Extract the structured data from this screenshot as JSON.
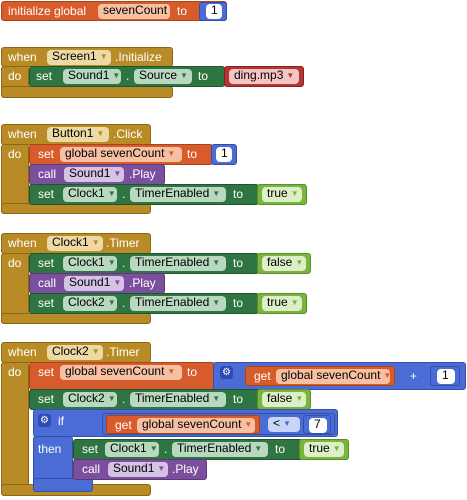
{
  "blocks": {
    "init_global": {
      "kw_initialize": "initialize global",
      "var_name": "sevenCount",
      "kw_to": "to",
      "value": "1"
    },
    "screen_init": {
      "kw_when": "when",
      "component": "Screen1",
      "event": ".Initialize",
      "kw_do": "do",
      "set_sound": {
        "kw_set": "set",
        "component": "Sound1",
        "dot": ".",
        "property": "Source",
        "kw_to": "to",
        "value": "ding.mp3"
      }
    },
    "button_click": {
      "kw_when": "when",
      "component": "Button1",
      "event": ".Click",
      "kw_do": "do",
      "set_global": {
        "kw_set": "set",
        "var": "global sevenCount",
        "kw_to": "to",
        "value": "1"
      },
      "call_play": {
        "kw_call": "call",
        "component": "Sound1",
        "method": ".Play"
      },
      "set_clock": {
        "kw_set": "set",
        "component": "Clock1",
        "dot": ".",
        "property": "TimerEnabled",
        "kw_to": "to",
        "value": "true"
      }
    },
    "clock1_timer": {
      "kw_when": "when",
      "component": "Clock1",
      "event": ".Timer",
      "kw_do": "do",
      "set_clock1": {
        "kw_set": "set",
        "component": "Clock1",
        "dot": ".",
        "property": "TimerEnabled",
        "kw_to": "to",
        "value": "false"
      },
      "call_play": {
        "kw_call": "call",
        "component": "Sound1",
        "method": ".Play"
      },
      "set_clock2": {
        "kw_set": "set",
        "component": "Clock2",
        "dot": ".",
        "property": "TimerEnabled",
        "kw_to": "to",
        "value": "true"
      }
    },
    "clock2_timer": {
      "kw_when": "when",
      "component": "Clock2",
      "event": ".Timer",
      "kw_do": "do",
      "set_global": {
        "kw_set": "set",
        "var": "global sevenCount",
        "kw_to": "to",
        "kw_get": "get",
        "get_var": "global sevenCount",
        "op": "+",
        "addend": "1"
      },
      "set_clock2": {
        "kw_set": "set",
        "component": "Clock2",
        "dot": ".",
        "property": "TimerEnabled",
        "kw_to": "to",
        "value": "false"
      },
      "if_block": {
        "kw_if": "if",
        "kw_get": "get",
        "get_var": "global sevenCount",
        "op": "<",
        "compare": "7",
        "kw_then": "then"
      },
      "then_set_clock1": {
        "kw_set": "set",
        "component": "Clock1",
        "dot": ".",
        "property": "TimerEnabled",
        "kw_to": "to",
        "value": "true"
      },
      "then_call_play": {
        "kw_call": "call",
        "component": "Sound1",
        "method": ".Play"
      }
    }
  },
  "icons": {
    "mutator": "gear-icon",
    "dropdown": "triangle-down-icon"
  },
  "colors": {
    "variable": "#d75b2b",
    "event": "#b98b27",
    "component_set": "#2f7541",
    "method_call": "#7b4f9d",
    "math": "#4a6cd4",
    "text": "#b33636",
    "logic": "#79b43d"
  }
}
